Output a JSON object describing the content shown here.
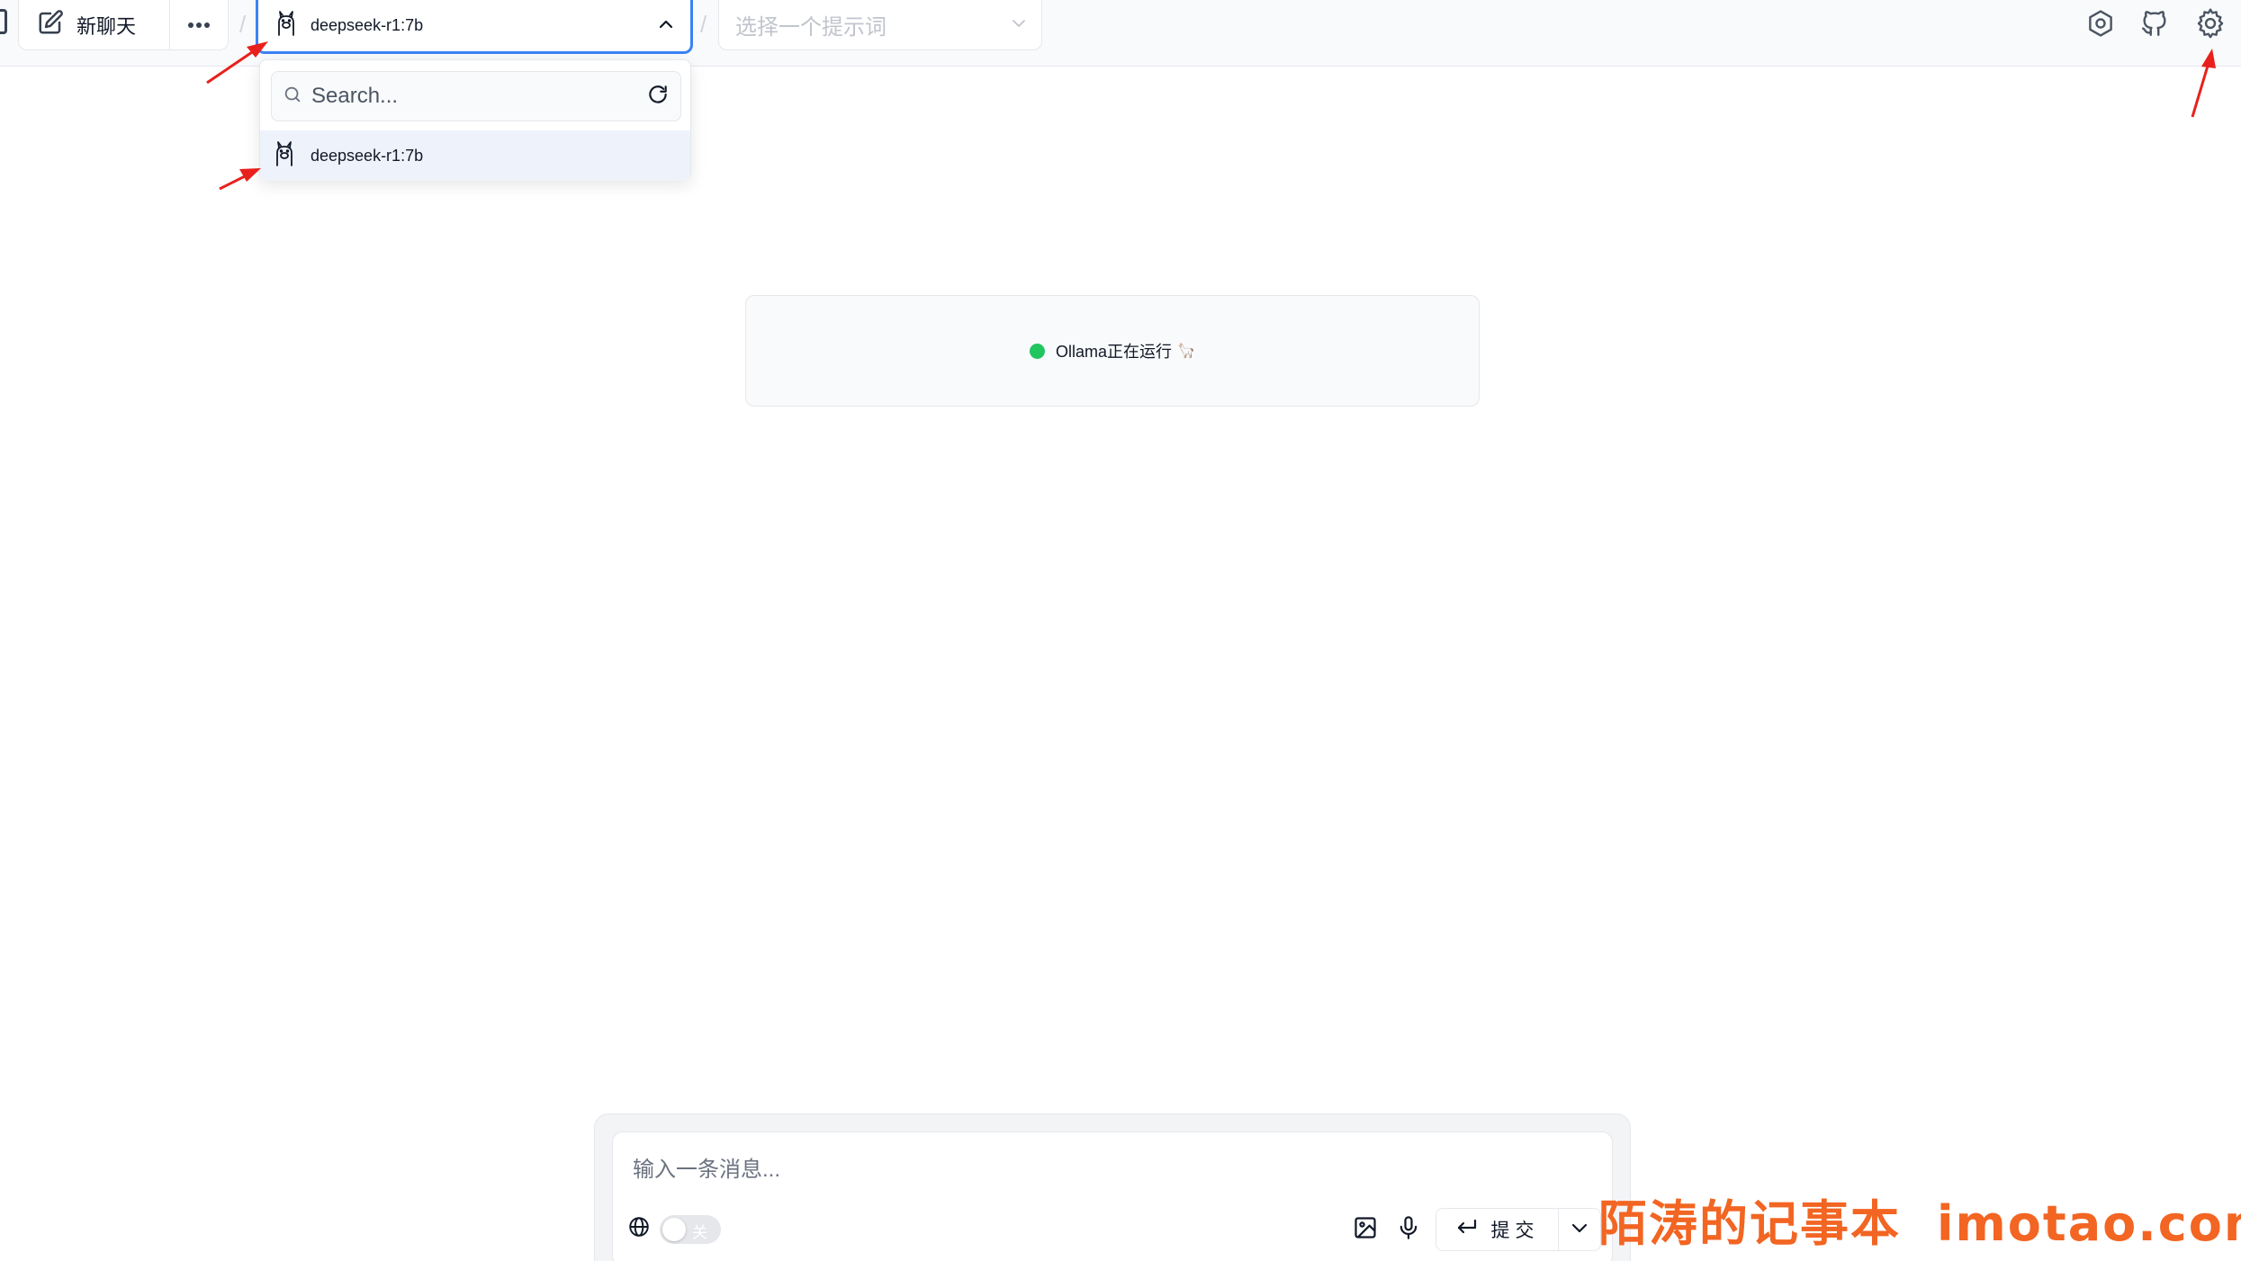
{
  "toolbar": {
    "new_chat_label": "新聊天",
    "separator": "/",
    "model_select": {
      "selected": "deepseek-r1:7b"
    },
    "prompt_select": {
      "placeholder": "选择一个提示词"
    }
  },
  "model_dropdown": {
    "search_placeholder": "Search...",
    "items": [
      {
        "label": "deepseek-r1:7b"
      }
    ]
  },
  "status": {
    "text": "Ollama正在运行",
    "emoji": "🦙",
    "dot_color": "#22c55e"
  },
  "composer": {
    "placeholder": "输入一条消息...",
    "web_search_toggle_label": "关",
    "web_search_enabled": false,
    "submit_label": "提交"
  },
  "watermark": {
    "cn": "陌涛的记事本",
    "url": "imotao.com",
    "color": "#f26522"
  },
  "colors": {
    "accent": "#3b82f6",
    "annotation_arrow": "#e8201c"
  }
}
